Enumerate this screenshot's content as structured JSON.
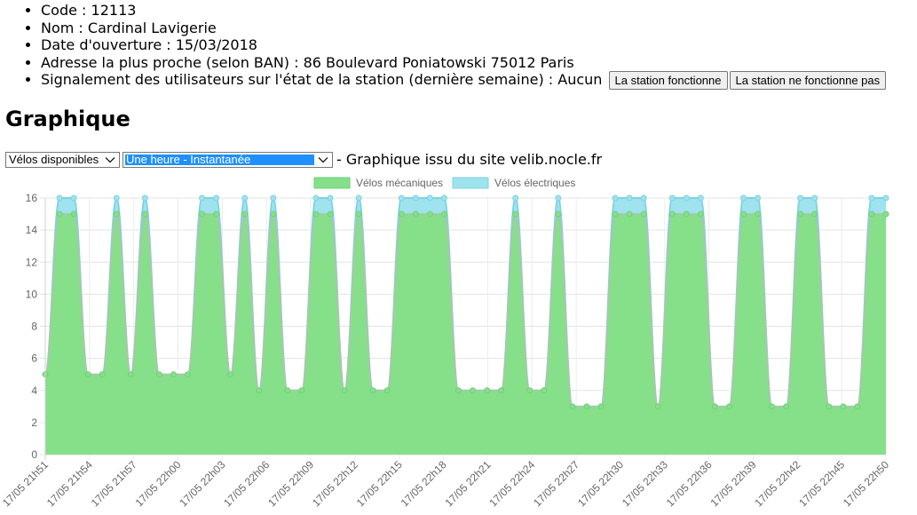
{
  "station": {
    "code_label": "Code : 12113",
    "name_label": "Nom : Cardinal Lavigerie",
    "opening_label": "Date d'ouverture : 15/03/2018",
    "address_label": "Adresse la plus proche (selon BAN) : 86 Boulevard Poniatowski 75012 Paris",
    "reports_label": "Signalement des utilisateurs sur l'état de la station (dernière semaine) : Aucun",
    "btn_working": "La station fonctionne",
    "btn_not_working": "La station ne fonctionne pas"
  },
  "section_title": "Graphique",
  "controls": {
    "metric_select": "Vélos disponibles",
    "period_select": "Une heure - Instantanée",
    "source_text": "- Graphique issu du site velib.nocle.fr"
  },
  "colors": {
    "mechanical": "#86e08a",
    "mechanical_line": "#6fd076",
    "electric": "#9fe3ef",
    "electric_line": "#7fd2e2"
  },
  "chart_data": {
    "type": "area",
    "stacked": true,
    "ylim": [
      0,
      16
    ],
    "yticks": [
      0,
      2,
      4,
      6,
      8,
      10,
      12,
      14,
      16
    ],
    "grid": true,
    "legend": "top-center",
    "x_tick_labels": [
      "17/05 21h51",
      "17/05 21h54",
      "17/05 21h57",
      "17/05 22h00",
      "17/05 22h03",
      "17/05 22h06",
      "17/05 22h09",
      "17/05 22h12",
      "17/05 22h15",
      "17/05 22h18",
      "17/05 22h21",
      "17/05 22h24",
      "17/05 22h27",
      "17/05 22h30",
      "17/05 22h33",
      "17/05 22h36",
      "17/05 22h39",
      "17/05 22h42",
      "17/05 22h45",
      "17/05 22h50"
    ],
    "series": [
      {
        "name": "Vélos mécaniques",
        "values": [
          5,
          15,
          15,
          5,
          5,
          15,
          5,
          15,
          5,
          5,
          5,
          15,
          15,
          5,
          15,
          4,
          15,
          4,
          4,
          15,
          15,
          4,
          15,
          4,
          4,
          15,
          15,
          15,
          15,
          4,
          4,
          4,
          4,
          15,
          4,
          4,
          15,
          3,
          3,
          3,
          15,
          15,
          15,
          3,
          15,
          15,
          15,
          3,
          3,
          15,
          15,
          3,
          3,
          15,
          15,
          3,
          3,
          3,
          15,
          15
        ]
      },
      {
        "name": "Vélos électriques",
        "values": [
          0,
          1,
          1,
          0,
          0,
          1,
          0,
          1,
          0,
          0,
          0,
          1,
          1,
          0,
          1,
          0,
          1,
          0,
          0,
          1,
          1,
          0,
          1,
          0,
          0,
          1,
          1,
          1,
          1,
          0,
          0,
          0,
          0,
          1,
          0,
          0,
          1,
          0,
          0,
          0,
          1,
          1,
          1,
          0,
          1,
          1,
          1,
          0,
          0,
          1,
          1,
          0,
          0,
          1,
          1,
          0,
          0,
          0,
          1,
          1
        ]
      }
    ]
  }
}
